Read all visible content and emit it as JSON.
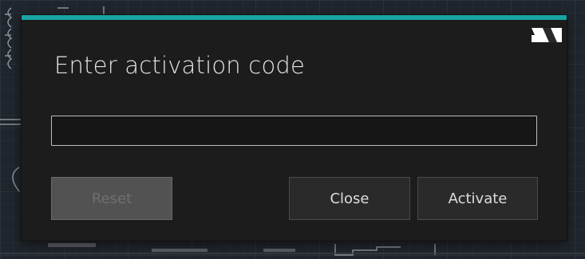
{
  "dialog": {
    "title": "Enter activation code",
    "accent_color": "#1aa4a4",
    "logo_icon": "brand-logo-icon",
    "code_input": {
      "value": "",
      "placeholder": ""
    },
    "buttons": {
      "reset_label": "Reset",
      "close_label": "Close",
      "activate_label": "Activate"
    }
  }
}
